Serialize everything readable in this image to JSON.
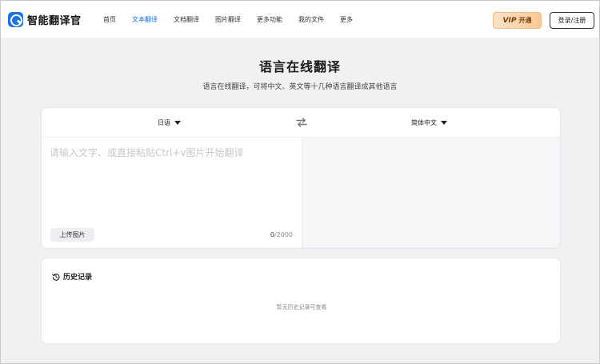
{
  "header": {
    "logo_text": "智能翻译官",
    "nav": [
      {
        "label": "首页",
        "active": false
      },
      {
        "label": "文本翻译",
        "active": true
      },
      {
        "label": "文档翻译",
        "active": false
      },
      {
        "label": "图片翻译",
        "active": false
      },
      {
        "label": "更多功能",
        "active": false
      },
      {
        "label": "我的文件",
        "active": false
      },
      {
        "label": "更多",
        "active": false
      }
    ],
    "vip_badge": "VIP",
    "vip_label": "开通",
    "login_label": "登录/注册"
  },
  "main": {
    "title": "语言在线翻译",
    "subtitle": "语言在线翻译，可将中文、英文等十几种语言翻译成其他语言"
  },
  "translator": {
    "source_lang": "日语",
    "target_lang": "简体中文",
    "input_value": "",
    "input_placeholder": "请输入文字、或直接粘贴Ctrl+v图片开始翻译",
    "upload_label": "上传图片",
    "char_count": "0",
    "char_limit": "/2000"
  },
  "history": {
    "title": "历史记录",
    "empty_text": "暂无历史记录可查看"
  },
  "colors": {
    "accent": "#1a6fe0",
    "vip_gradient_start": "#fde3c8",
    "vip_gradient_end": "#f9c995",
    "page_bg": "#f0f1f3"
  },
  "icons": {
    "logo": "translate-logo-icon",
    "swap": "swap-arrows-icon",
    "history": "history-clock-icon",
    "dropdown": "caret-down-icon"
  }
}
